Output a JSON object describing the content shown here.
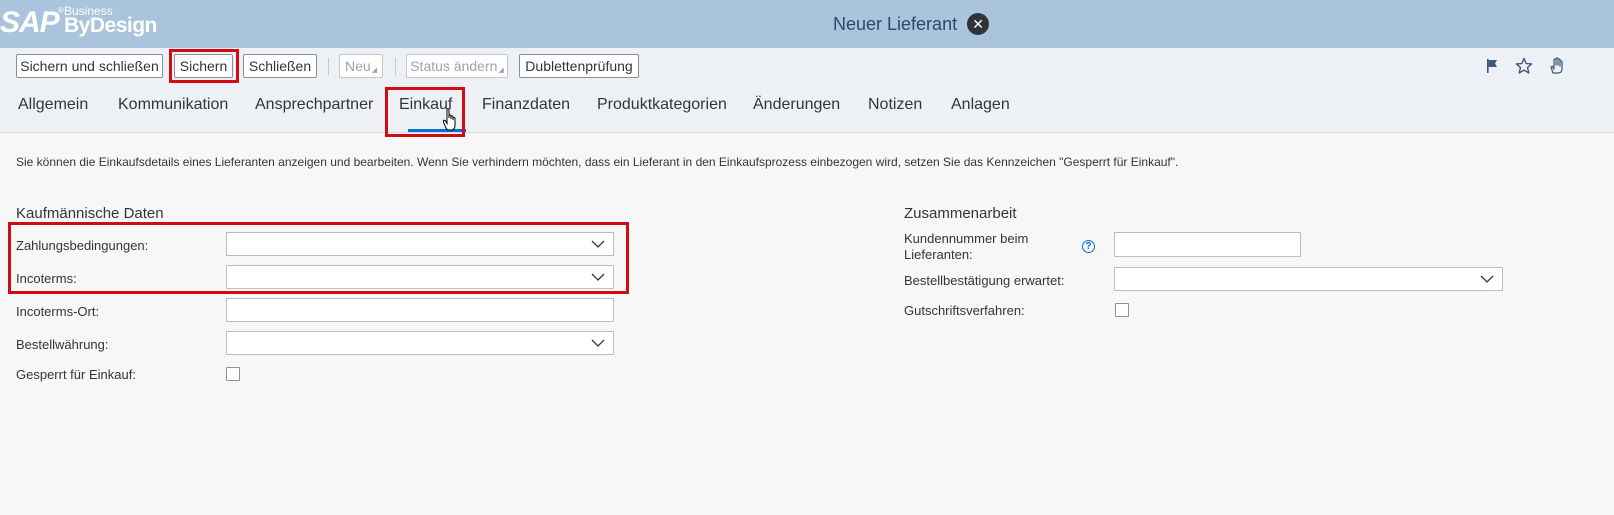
{
  "header": {
    "logo": {
      "sap": "SAP",
      "business": "Business",
      "bydesign": "ByDesign",
      "reg": "®"
    },
    "title": "Neuer Lieferant",
    "close_icon": "close-circle-icon"
  },
  "toolbar": {
    "save_close": "Sichern und schließen",
    "save": "Sichern",
    "close": "Schließen",
    "new": "Neu",
    "status_change": "Status ändern",
    "duplicate_check": "Dublettenprüfung",
    "right_icons": [
      "flag-icon",
      "star-icon",
      "hand-icon"
    ]
  },
  "tabs": [
    {
      "label": "Allgemein"
    },
    {
      "label": "Kommunikation"
    },
    {
      "label": "Ansprechpartner"
    },
    {
      "label": "Einkauf",
      "active": true
    },
    {
      "label": "Finanzdaten"
    },
    {
      "label": "Produktkategorien"
    },
    {
      "label": "Änderungen"
    },
    {
      "label": "Notizen"
    },
    {
      "label": "Anlagen"
    }
  ],
  "info_text": "Sie können die Einkaufsdetails eines Lieferanten anzeigen und bearbeiten. Wenn Sie verhindern möchten, dass ein Lieferant in den Einkaufsprozess einbezogen wird, setzen Sie das Kennzeichen \"Gesperrt für Einkauf\".",
  "commercial": {
    "title": "Kaufmännische Daten",
    "payment_terms": {
      "label": "Zahlungsbedingungen:",
      "value": ""
    },
    "incoterms": {
      "label": "Incoterms:",
      "value": ""
    },
    "incoterms_place": {
      "label": "Incoterms-Ort:",
      "value": ""
    },
    "order_currency": {
      "label": "Bestellwährung:",
      "value": ""
    },
    "blocked_purchasing": {
      "label": "Gesperrt für Einkauf:",
      "checked": false
    }
  },
  "collaboration": {
    "title": "Zusammenarbeit",
    "customer_number": {
      "label": "Kundennummer beim Lieferanten:",
      "value": ""
    },
    "order_confirmation": {
      "label": "Bestellbestätigung erwartet:",
      "value": ""
    },
    "credit_memo": {
      "label": "Gutschriftsverfahren:",
      "checked": false
    }
  },
  "colors": {
    "header_bg": "#a9c4dc",
    "toolbar_bg": "#edf1f5",
    "highlight_red": "#d10c14",
    "accent_blue": "#0a6ed1"
  }
}
